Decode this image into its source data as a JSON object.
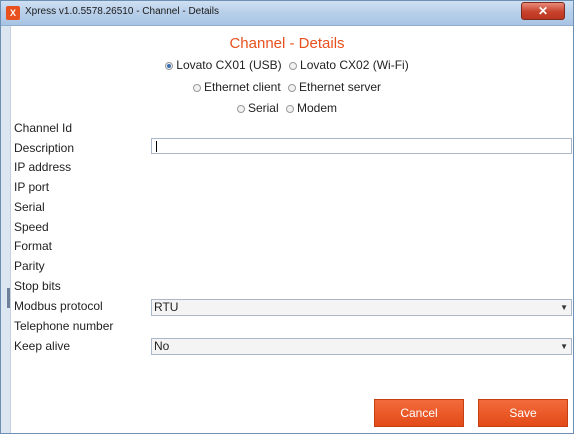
{
  "window": {
    "title": "Xpress v1.0.5578.26510 - Channel - Details",
    "close_glyph": "✕"
  },
  "heading": "Channel - Details",
  "channel_types": [
    {
      "label": "Lovato CX01 (USB)",
      "checked": true
    },
    {
      "label": "Lovato CX02 (Wi-Fi)",
      "checked": false
    },
    {
      "label": "Ethernet client",
      "checked": false
    },
    {
      "label": "Ethernet server",
      "checked": false
    },
    {
      "label": "Serial",
      "checked": false
    },
    {
      "label": "Modem",
      "checked": false
    }
  ],
  "fields": {
    "channel_id": "Channel Id",
    "description": "Description",
    "ip_address": "IP address",
    "ip_port": "IP port",
    "serial": "Serial",
    "speed": "Speed",
    "format": "Format",
    "parity": "Parity",
    "stop_bits": "Stop bits",
    "modbus_protocol": "Modbus protocol",
    "telephone_number": "Telephone number",
    "keep_alive": "Keep alive"
  },
  "values": {
    "description": "",
    "modbus_protocol": "RTU",
    "keep_alive": "No"
  },
  "buttons": {
    "cancel": "Cancel",
    "save": "Save"
  },
  "colors": {
    "accent": "#e8501e"
  }
}
